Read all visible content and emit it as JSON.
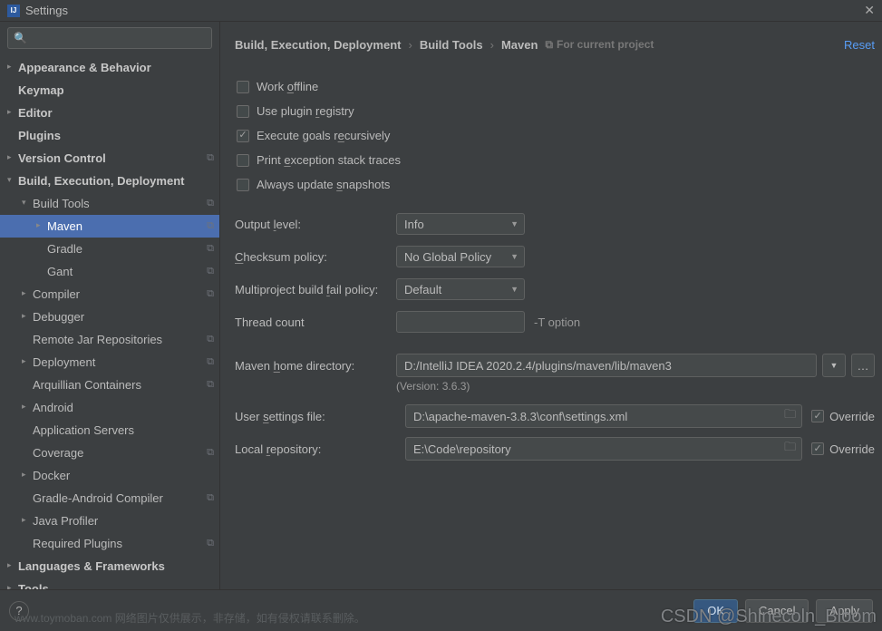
{
  "window": {
    "title": "Settings"
  },
  "sidebar": {
    "search_placeholder": "",
    "items": [
      {
        "label": "Appearance & Behavior",
        "bold": true,
        "chev": "right",
        "indent": 0
      },
      {
        "label": "Keymap",
        "bold": true,
        "chev": "none",
        "indent": 0
      },
      {
        "label": "Editor",
        "bold": true,
        "chev": "right",
        "indent": 0
      },
      {
        "label": "Plugins",
        "bold": true,
        "chev": "none",
        "indent": 0
      },
      {
        "label": "Version Control",
        "bold": true,
        "chev": "right",
        "indent": 0,
        "sep": true
      },
      {
        "label": "Build, Execution, Deployment",
        "bold": true,
        "chev": "down",
        "indent": 0
      },
      {
        "label": "Build Tools",
        "chev": "down",
        "indent": 1,
        "sep": true
      },
      {
        "label": "Maven",
        "chev": "right",
        "indent": 2,
        "sep": true,
        "selected": true
      },
      {
        "label": "Gradle",
        "chev": "none",
        "indent": 2,
        "sep": true
      },
      {
        "label": "Gant",
        "chev": "none",
        "indent": 2,
        "sep": true
      },
      {
        "label": "Compiler",
        "chev": "right",
        "indent": 1,
        "sep": true
      },
      {
        "label": "Debugger",
        "chev": "right",
        "indent": 1
      },
      {
        "label": "Remote Jar Repositories",
        "chev": "none",
        "indent": 1,
        "sep": true
      },
      {
        "label": "Deployment",
        "chev": "right",
        "indent": 1,
        "sep": true
      },
      {
        "label": "Arquillian Containers",
        "chev": "none",
        "indent": 1,
        "sep": true
      },
      {
        "label": "Android",
        "chev": "right",
        "indent": 1
      },
      {
        "label": "Application Servers",
        "chev": "none",
        "indent": 1
      },
      {
        "label": "Coverage",
        "chev": "none",
        "indent": 1,
        "sep": true
      },
      {
        "label": "Docker",
        "chev": "right",
        "indent": 1
      },
      {
        "label": "Gradle-Android Compiler",
        "chev": "none",
        "indent": 1,
        "sep": true
      },
      {
        "label": "Java Profiler",
        "chev": "right",
        "indent": 1
      },
      {
        "label": "Required Plugins",
        "chev": "none",
        "indent": 1,
        "sep": true
      },
      {
        "label": "Languages & Frameworks",
        "bold": true,
        "chev": "right",
        "indent": 0
      },
      {
        "label": "Tools",
        "bold": true,
        "chev": "right",
        "indent": 0
      }
    ]
  },
  "breadcrumb": {
    "a": "Build, Execution, Deployment",
    "b": "Build Tools",
    "c": "Maven",
    "scope": "For current project",
    "reset": "Reset"
  },
  "form": {
    "cb_work_offline": "Work offline",
    "cb_plugin_registry": "Use plugin registry",
    "cb_recursive": "Execute goals recursively",
    "cb_stack_traces": "Print exception stack traces",
    "cb_snapshots": "Always update snapshots",
    "output_level_label": "Output level:",
    "output_level_value": "Info",
    "checksum_label": "Checksum policy:",
    "checksum_value": "No Global Policy",
    "multi_fail_label": "Multiproject build fail policy:",
    "multi_fail_value": "Default",
    "thread_label": "Thread count",
    "thread_value": "",
    "thread_hint": "-T option",
    "home_label": "Maven home directory:",
    "home_value": "D:/IntelliJ IDEA 2020.2.4/plugins/maven/lib/maven3",
    "version_hint": "(Version: 3.6.3)",
    "settings_label": "User settings file:",
    "settings_value": "D:\\apache-maven-3.8.3\\conf\\settings.xml",
    "repo_label": "Local repository:",
    "repo_value": "E:\\Code\\repository",
    "override": "Override"
  },
  "footer": {
    "ok": "OK",
    "cancel": "Cancel",
    "apply": "Apply"
  },
  "watermark1": "www.toymoban.com 网络图片仅供展示，非存储，如有侵权请联系删除。",
  "watermark2": "CSDN @Shinecoln_Bloom"
}
